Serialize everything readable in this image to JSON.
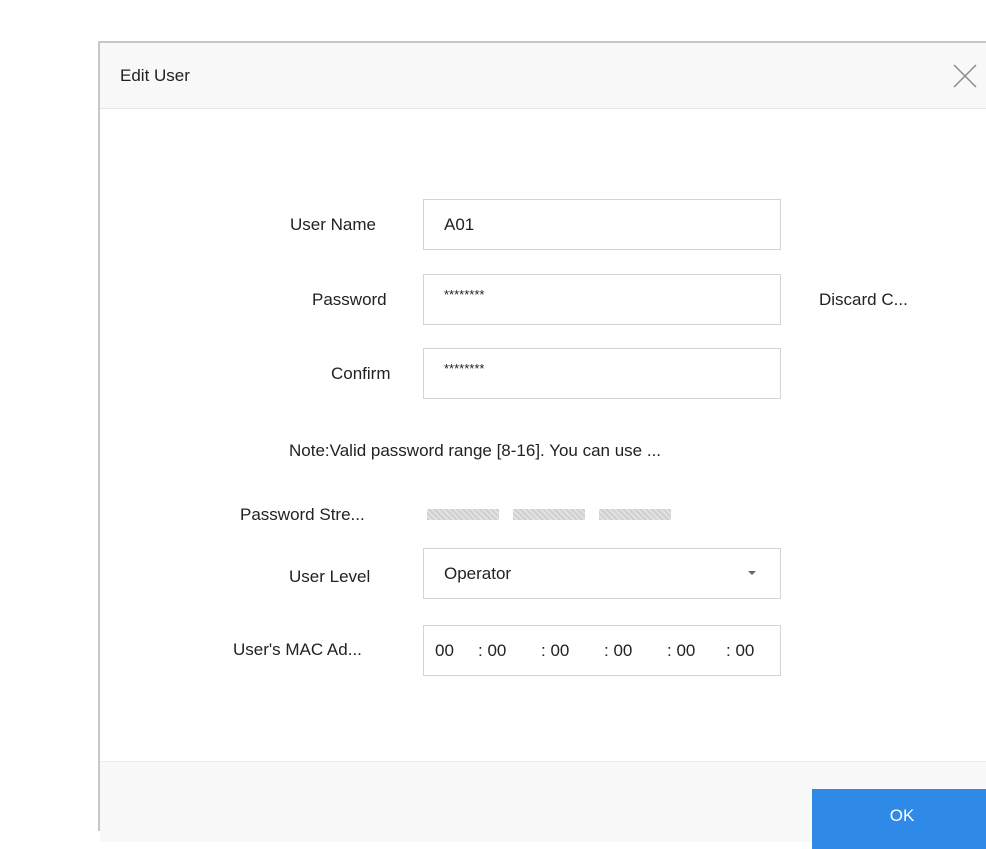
{
  "dialog": {
    "title": "Edit User",
    "close_icon": "close-icon"
  },
  "form": {
    "user_name": {
      "label": "User Name",
      "value": "A01"
    },
    "password": {
      "label": "Password",
      "value": "********"
    },
    "confirm": {
      "label": "Confirm",
      "value": "********"
    },
    "discard_label": "Discard C...",
    "note": "Note:Valid password range [8-16]. You can use ...",
    "password_strength": {
      "label": "Password Stre..."
    },
    "user_level": {
      "label": "User Level",
      "value": "Operator",
      "icon": "chevron-down-icon"
    },
    "mac": {
      "label": "User's MAC Ad...",
      "segments": [
        "00",
        ": 00",
        ": 00",
        ": 00",
        ": 00",
        ": 00"
      ]
    }
  },
  "footer": {
    "ok_label": "OK"
  },
  "colors": {
    "accent": "#2e8ae6",
    "border": "#d4d4d4",
    "strength_inactive": "#d7d7d7"
  }
}
